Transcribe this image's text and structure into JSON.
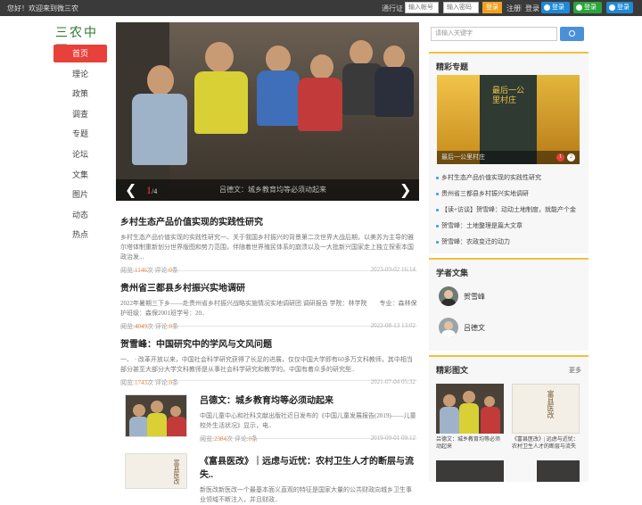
{
  "topbar": {
    "welcome": "您好！欢迎来到微三农",
    "login_label": "通行证",
    "user_placeholder": "输入帐号",
    "pass_placeholder": "输入密码",
    "login_btn": "登录",
    "register": "注册",
    "separator": "|",
    "login_link": "登录",
    "social": [
      {
        "label": "登录",
        "icon": "qq-icon",
        "color": "#1e8ad6"
      },
      {
        "label": "登录",
        "icon": "wechat-icon",
        "color": "#2aa53c"
      },
      {
        "label": "登录",
        "icon": "weibo-icon",
        "color": "#1e8ad6"
      }
    ]
  },
  "logo": "三农中国",
  "nav": [
    {
      "label": "首页",
      "active": true
    },
    {
      "label": "理论"
    },
    {
      "label": "政策"
    },
    {
      "label": "调查"
    },
    {
      "label": "专题"
    },
    {
      "label": "论坛"
    },
    {
      "label": "文集"
    },
    {
      "label": "图片"
    },
    {
      "label": "动态"
    },
    {
      "label": "热点"
    }
  ],
  "slider": {
    "current": "1",
    "total": "/4",
    "caption": "吕德文：城乡教育均等必须动起来",
    "prev_icon": "chevron-left-icon",
    "next_icon": "chevron-right-icon"
  },
  "articles": [
    {
      "title": "乡村生态产品价值实现的实践性研究",
      "summary": "乡村生态产品价值实现的实践性研究一、关于我国乡村振兴的背景第二次世界大战后期，以美苏为主导的雅尔塔体制重新划分世界版图和势力范围，伴随着世界殖民体系的崩溃以及一大批新兴国家走上独立探索本国政治发...",
      "views_label": "阅览:",
      "views": "1146",
      "comments_label": "次 评论:",
      "comments": "0",
      "unit": "条",
      "date": "2023-09-02 16:14"
    },
    {
      "title": "贵州省三都县乡村振兴实地调研",
      "summary": "2022年暑期三下乡——赴贵州省乡村振兴战略实施情况实地调研团 调研报告 学院：林学院　　专业：森林保护班级：森保2001班学号：20..",
      "views_label": "阅览:",
      "views": "4049",
      "comments_label": "次 评论:",
      "comments": "0",
      "unit": "条",
      "date": "2022-08-13 13:02"
    },
    {
      "title": "贺雪峰：中国研究中的学风与文风问题",
      "summary": "一、 · 改革开放以来，中国社会科学研究获得了长足的进展，仅仅中国大学即有60多万文科教师，其中相当部分甚至大部分大学文科教师是从事社会科学研究和教学的。中国有着众多的研究型..",
      "views_label": "阅览:",
      "views": "1743",
      "comments_label": "次 评论:",
      "comments": "0",
      "unit": "条",
      "date": "2021-07-04 05:32"
    },
    {
      "title": "吕德文：城乡教育均等必须动起来",
      "summary": "中国儿童中心和社科文献出版社近日发布的《中国儿童发展报告(2019)——儿童校外生活状况》显示，电..",
      "views_label": "阅览:",
      "views": "2384",
      "comments_label": "次 评论:",
      "comments": "0",
      "unit": "条",
      "date": "2019-09-01 09:12"
    },
    {
      "title": "《富县医改》｜远虑与近忧：农村卫生人才的断层与流失..",
      "summary": "新医改新医改一个最基本面义直观的特征是国家大量的公共财政向城乡卫生事业领域不断注入，并且财政..",
      "views_label": "",
      "views": "",
      "comments_label": "",
      "comments": "",
      "unit": "",
      "date": ""
    }
  ],
  "search": {
    "placeholder": "请输入关键字"
  },
  "special": {
    "heading": "精彩专题",
    "img_caption": "最后一公里村庄",
    "img_title": "最后一公里村庄",
    "dots": [
      "1",
      "2"
    ],
    "items": [
      "乡村生态产品价值实现的实践性研究",
      "贵州省三都县乡村振兴实地调研",
      "【读+访谈】贺雪峰：动动土地制度，就能产个金",
      "贺雪峰：土地整理是篇大文章",
      "贺雪峰：农政变迁的动力"
    ]
  },
  "scholars": {
    "heading": "学者文集",
    "items": [
      "贺雪峰",
      "吕德文"
    ]
  },
  "pictures": {
    "heading": "精彩图文",
    "more": "更多",
    "items": [
      {
        "caption": "吕德文：城乡教育均等必须动起来"
      },
      {
        "caption": "《富县医改》| 远虑与近忧：农村卫生人才的断层与流失"
      }
    ],
    "book_title": "富县医改"
  },
  "colors": {
    "accent": "#e8403a",
    "brand_green": "#2e7a2e",
    "link_orange": "#e8803a",
    "highlight": "#f0c040",
    "search_blue": "#4a90d9"
  }
}
